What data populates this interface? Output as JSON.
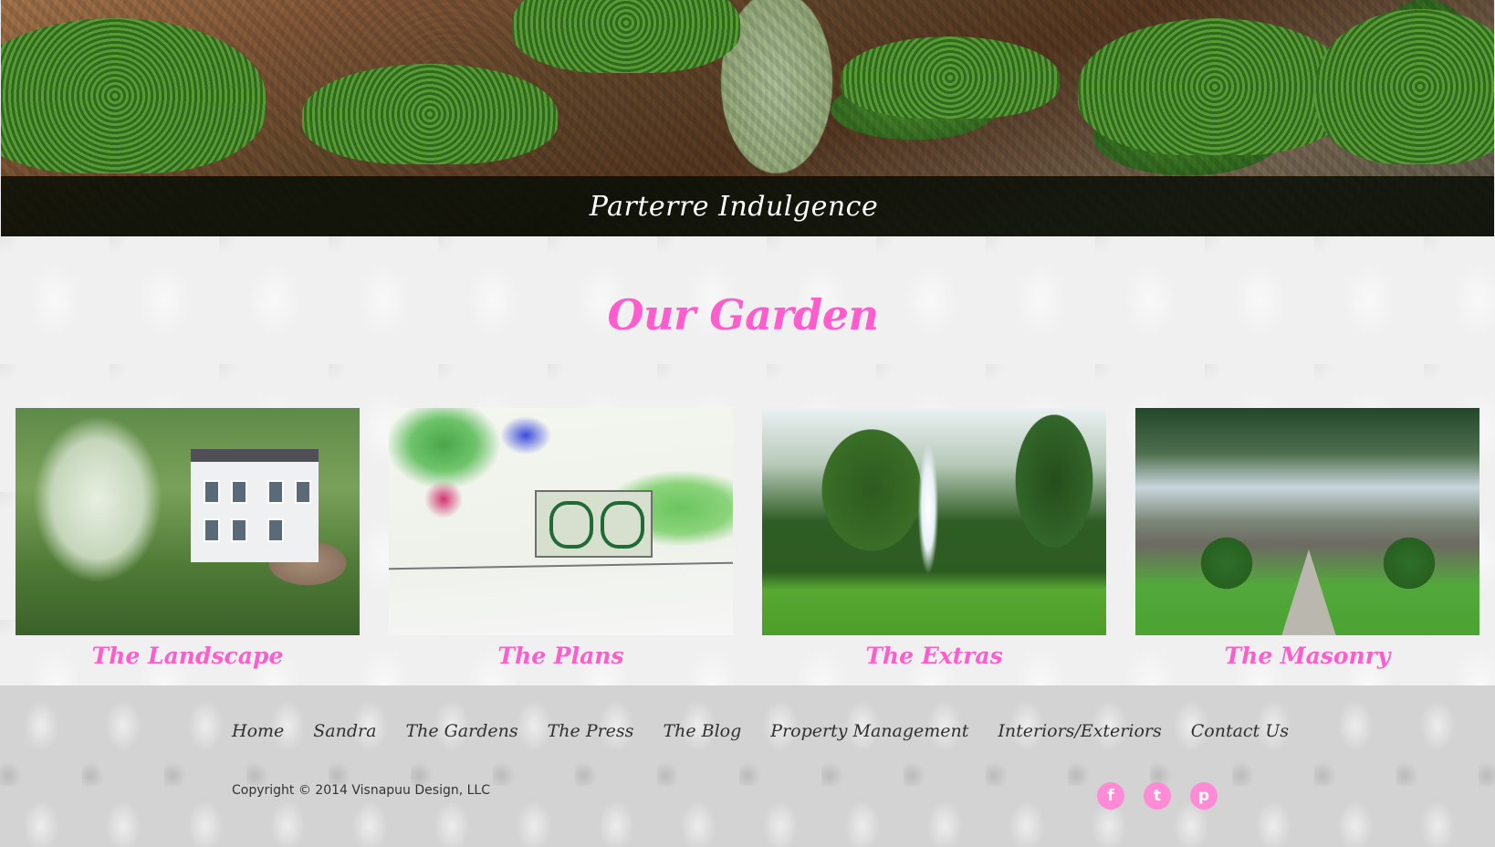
{
  "hero": {
    "caption": "Parterre Indulgence",
    "slide_count": 4,
    "active_slide": 4
  },
  "page": {
    "title": "Our Garden"
  },
  "gallery": [
    {
      "label": "The Landscape"
    },
    {
      "label": "The Plans"
    },
    {
      "label": "The Extras"
    },
    {
      "label": "The Masonry"
    }
  ],
  "footer": {
    "nav": [
      "Home",
      "Sandra",
      "The Gardens",
      "The Press",
      "The Blog",
      "Property Management",
      "Interiors/Exteriors",
      "Contact Us"
    ],
    "copyright": "Copyright © 2014 Visnapuu Design, LLC",
    "social": [
      {
        "name": "facebook-icon",
        "glyph": "f"
      },
      {
        "name": "twitter-icon",
        "glyph": "t"
      },
      {
        "name": "pinterest-icon",
        "glyph": "p"
      }
    ]
  },
  "colors": {
    "accent": "#ff5ccd",
    "social_icon": "#ff8ad6",
    "caption_bar": "#0b1209"
  }
}
